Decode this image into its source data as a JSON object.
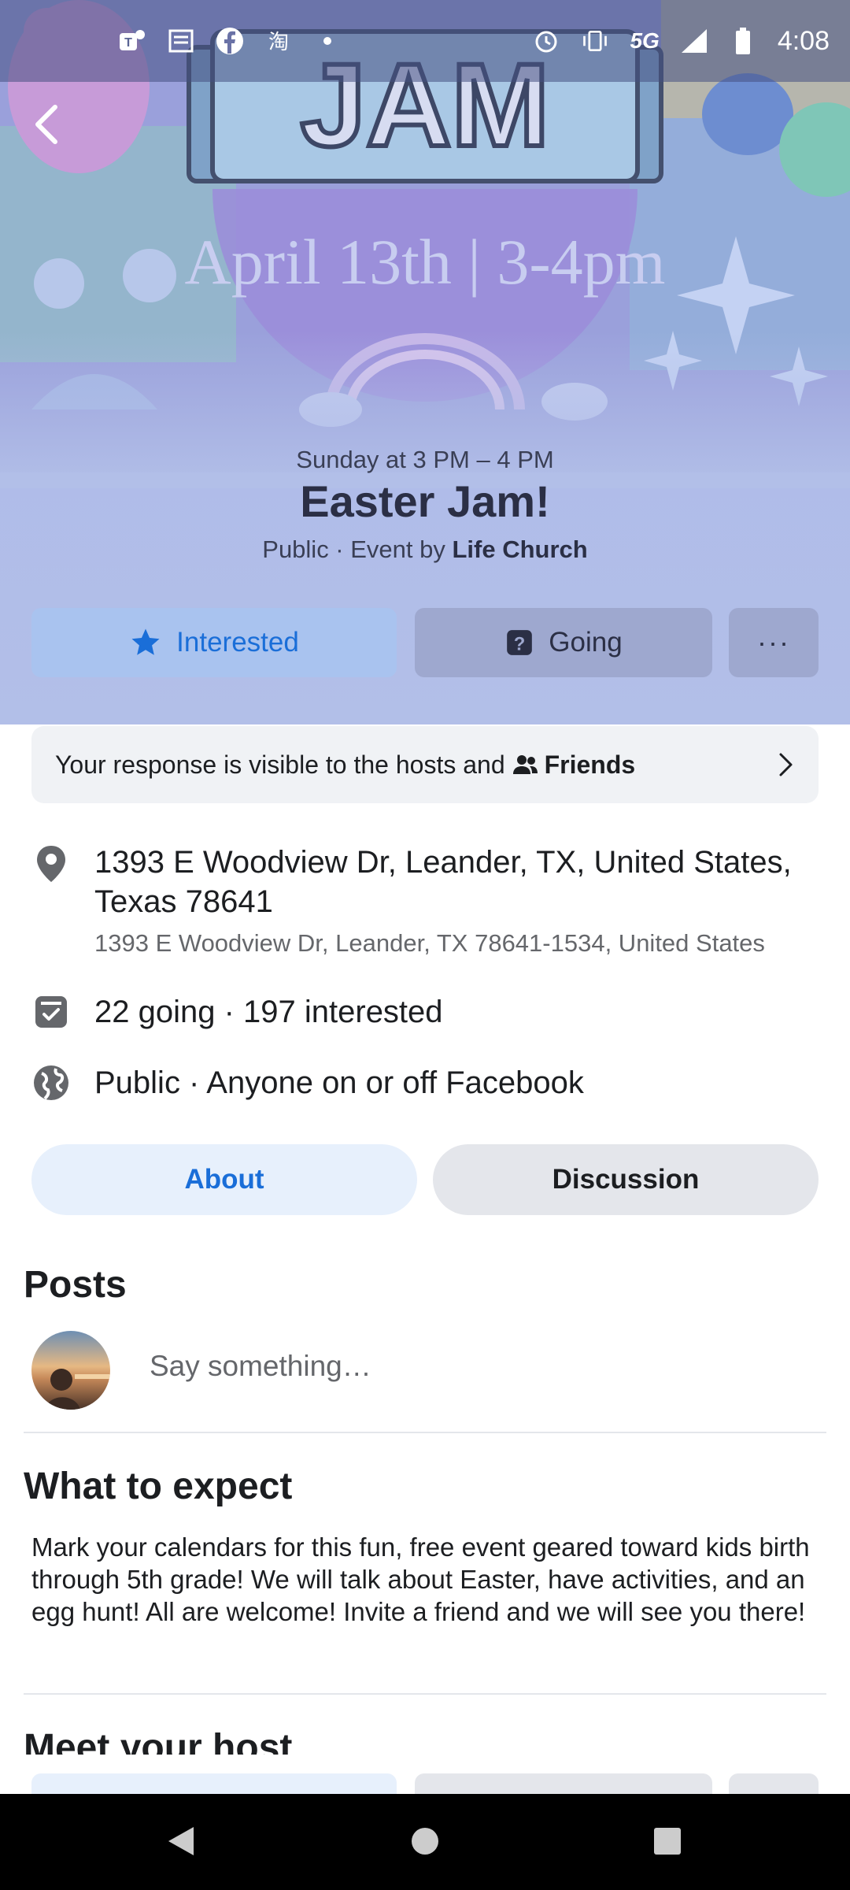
{
  "status_bar": {
    "time": "4:08",
    "network": "5G",
    "left_icons": [
      "teams-icon",
      "news-icon",
      "facebook-icon",
      "taobao-icon",
      "dot-icon"
    ],
    "right_icons": [
      "alarm-icon",
      "vibrate-icon",
      "signal-icon",
      "battery-icon"
    ]
  },
  "cover": {
    "art_text_top": "JAM",
    "art_text_date": "April 13th | 3-4pm"
  },
  "event": {
    "datetime": "Sunday at 3 PM – 4 PM",
    "title": "Easter Jam!",
    "meta_prefix": "Public · Event by ",
    "host": "Life Church"
  },
  "actions": {
    "interested": "Interested",
    "going": "Going",
    "more": "···"
  },
  "response_card": {
    "text": "Your response is visible to the hosts and",
    "audience": "Friends"
  },
  "details": {
    "address_line": "1393 E Woodview Dr, Leander, TX, United States, Texas 78641",
    "address_sub": "1393 E Woodview Dr, Leander, TX 78641-1534, United States",
    "attendance": "22 going · 197 interested",
    "privacy": "Public · Anyone on or off Facebook"
  },
  "tabs": {
    "about": "About",
    "discussion": "Discussion"
  },
  "posts": {
    "title": "Posts",
    "placeholder": "Say something…"
  },
  "expect": {
    "title": "What to expect",
    "body": "Mark your calendars for this fun, free event geared toward kids birth through 5th grade! We will talk about Easter, have activities, and an egg hunt! All are welcome! Invite a friend and we will see you there!"
  },
  "host_section": {
    "title": "Meet your host"
  },
  "colors": {
    "accent": "#1a6ed8",
    "hero_bg": "#b2bfe8",
    "button_tint": "#9ea8cf"
  }
}
